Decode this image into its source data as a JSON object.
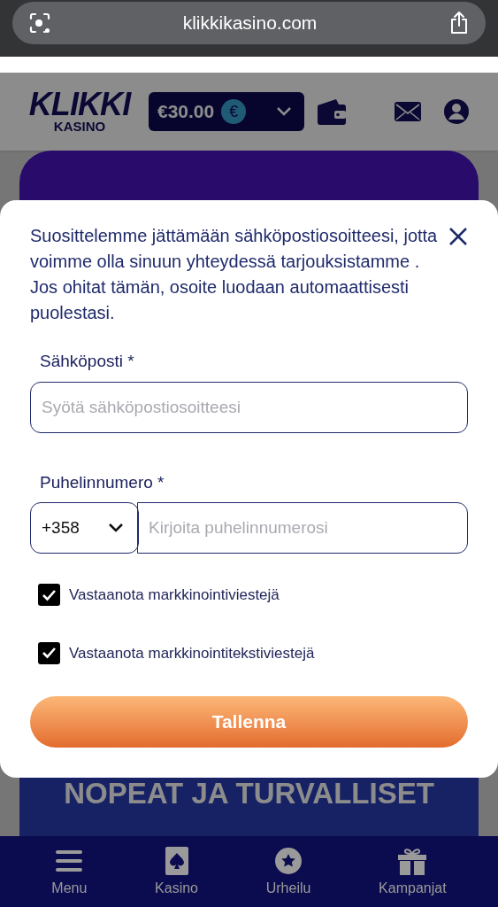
{
  "browser": {
    "url": "klikkikasino.com"
  },
  "header": {
    "logo": {
      "word": "KLIKKI",
      "subword": "KASINO"
    },
    "balance": "€30.00",
    "currency_symbol": "€"
  },
  "promo": {
    "lines": [
      "NOPEAT JA TURVALLISET"
    ]
  },
  "modal": {
    "message": "Suosittelemme jättämään sähköpostiosoitteesi, jotta voimme olla sinuun yhteydessä tarjouksistamme . Jos ohitat tämän, osoite luodaan automaattisesti puolestasi.",
    "email": {
      "label": "Sähköposti *",
      "placeholder": "Syötä sähköpostiosoitteesi"
    },
    "phone": {
      "label": "Puhelinnumero *",
      "country_code": "+358",
      "placeholder": "Kirjoita puhelinnumerosi"
    },
    "checkboxes": [
      {
        "label": "Vastaanota markkinointiviestejä",
        "checked": true
      },
      {
        "label": "Vastaanota markkinointitekstiviestejä",
        "checked": true
      }
    ],
    "submit": "Tallenna"
  },
  "bottom_nav": [
    {
      "label": "Menu",
      "kind": "menu"
    },
    {
      "label": "Kasino",
      "kind": "card"
    },
    {
      "label": "Urheilu",
      "kind": "badge"
    },
    {
      "label": "Kampanjat",
      "kind": "gift"
    }
  ]
}
